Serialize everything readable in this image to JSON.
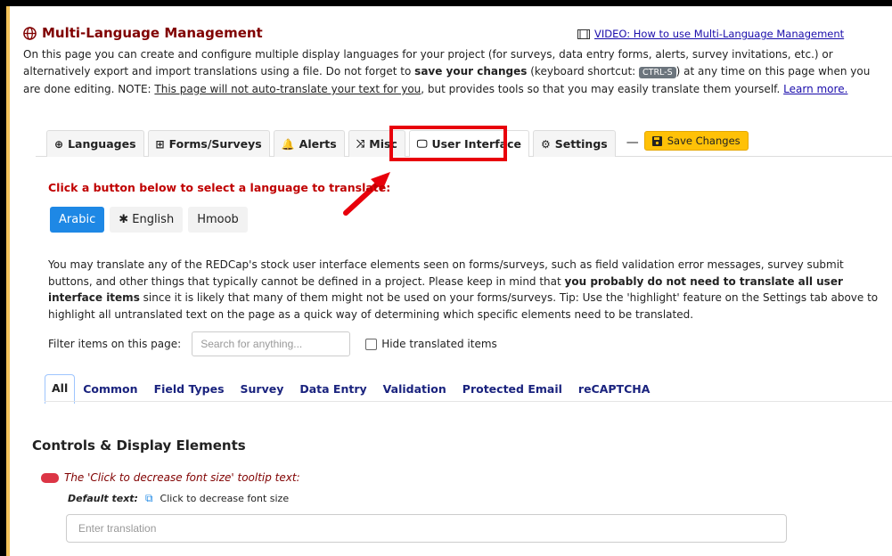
{
  "header": {
    "title": "Multi-Language Management",
    "video_link": "VIDEO: How to use Multi-Language Management"
  },
  "intro": {
    "p1": "On this page you can create and configure multiple display languages for your project (for surveys, data entry forms, alerts, survey invitations, etc.) or alternatively export and import translations using a file. Do not forget to ",
    "bold": "save your changes",
    "p2": " (keyboard shortcut: ",
    "kbd": "CTRL-S",
    "p3": ") at any time on this page when you are done editing. NOTE: ",
    "underline": "This page will not auto-translate your text for you",
    "p4": ", but provides tools so that you may easily translate them yourself. ",
    "learn_more": "Learn more."
  },
  "tabs": [
    {
      "label": "Languages",
      "icon": "globe-icon",
      "glyph": "⊕"
    },
    {
      "label": "Forms/Surveys",
      "icon": "table-icon",
      "glyph": "⊞"
    },
    {
      "label": "Alerts",
      "icon": "bell-icon",
      "glyph": "🔔"
    },
    {
      "label": "Misc",
      "icon": "shuffle-icon",
      "glyph": "⤨"
    },
    {
      "label": "User Interface",
      "icon": "monitor-icon",
      "glyph": "🖵"
    },
    {
      "label": "Settings",
      "icon": "gear-icon",
      "glyph": "⚙"
    }
  ],
  "active_tab": "User Interface",
  "save_button": "Save Changes",
  "select_language_label": "Click a button below to select a language to translate:",
  "languages": [
    "Arabic",
    "✱ English",
    "Hmoob"
  ],
  "active_language": "Arabic",
  "description": {
    "p1": "You may translate any of the REDCap's stock user interface elements seen on forms/surveys, such as field validation error messages, survey submit buttons, and other things that typically cannot be defined in a project. Please keep in mind that ",
    "bold": "you probably do not need to translate all user interface items",
    "p2": " since it is likely that many of them might not be used on your forms/surveys. Tip: Use the 'highlight' feature on the Settings tab above to highlight all untranslated text on the page as a quick way of determining which specific elements need to be translated."
  },
  "filter": {
    "label": "Filter items on this page:",
    "placeholder": "Search for anything...",
    "hide_label": "Hide translated items"
  },
  "subtabs": [
    "All",
    "Common",
    "Field Types",
    "Survey",
    "Data Entry",
    "Validation",
    "Protected Email",
    "reCAPTCHA"
  ],
  "section_title": "Controls & Display Elements",
  "item": {
    "label": "The 'Click to decrease font size' tooltip text:",
    "default_label": "Default text:",
    "default_value": "Click to decrease font size",
    "placeholder": "Enter translation"
  },
  "colors": {
    "title": "#800000",
    "highlight": "#e8000b",
    "save": "#ffc107",
    "lang_active": "#1e88e5"
  }
}
